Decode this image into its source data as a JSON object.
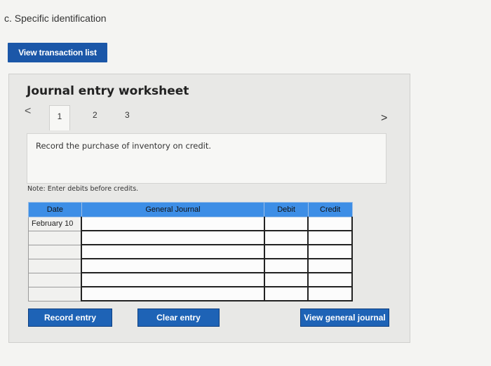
{
  "heading": "c. Specific identification",
  "buttons": {
    "view_transactions": "View transaction list",
    "record_entry": "Record entry",
    "clear_entry": "Clear entry",
    "view_general_journal": "View general journal"
  },
  "worksheet": {
    "title": "Journal entry worksheet",
    "nav_prev": "<",
    "nav_next": ">",
    "tabs": [
      "1",
      "2",
      "3"
    ],
    "instruction": "Record the purchase of inventory on credit.",
    "note": "Note: Enter debits before credits."
  },
  "table": {
    "headers": [
      "Date",
      "General Journal",
      "Debit",
      "Credit"
    ],
    "rows": [
      {
        "date": "February 10"
      },
      {
        "date": ""
      },
      {
        "date": ""
      },
      {
        "date": ""
      },
      {
        "date": ""
      },
      {
        "date": ""
      }
    ]
  },
  "colors": {
    "button_blue": "#1b57a8",
    "table_header": "#3d8ee6"
  }
}
